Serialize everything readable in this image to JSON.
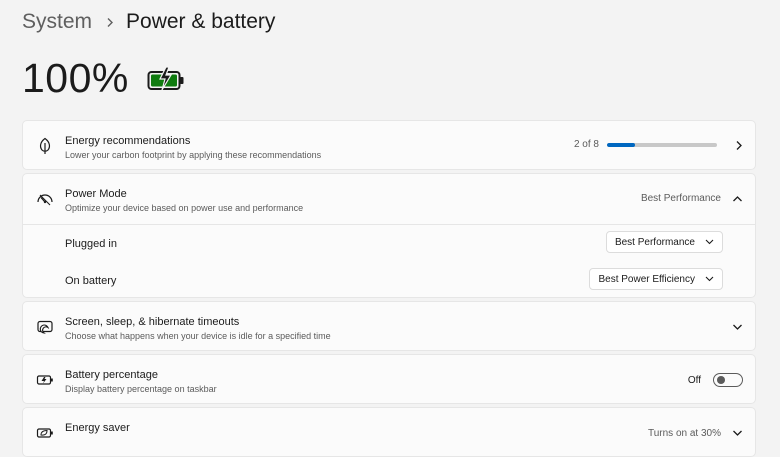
{
  "breadcrumb": {
    "parent": "System",
    "current": "Power & battery"
  },
  "battery": {
    "percent_text": "100%",
    "charge_level": 1.0,
    "color": "#107c10"
  },
  "energy_recommendations": {
    "title": "Energy recommendations",
    "subtitle": "Lower your carbon footprint by applying these recommendations",
    "progress_text": "2 of 8",
    "progress": 0.25,
    "icon": "leaf-icon"
  },
  "power_mode": {
    "title": "Power Mode",
    "subtitle": "Optimize your device based on power use and performance",
    "value": "Best Performance",
    "icon": "power-mode-icon",
    "plugged_in": {
      "label": "Plugged in",
      "value": "Best Performance"
    },
    "on_battery": {
      "label": "On battery",
      "value": "Best Power Efficiency"
    }
  },
  "screen_sleep": {
    "title": "Screen, sleep, & hibernate timeouts",
    "subtitle": "Choose what happens when your device is idle for a specified time",
    "icon": "screen-sleep-icon"
  },
  "battery_percentage": {
    "title": "Battery percentage",
    "subtitle": "Display battery percentage on taskbar",
    "toggle_label": "Off",
    "toggle_on": false,
    "icon": "battery-percentage-icon"
  },
  "energy_saver": {
    "title": "Energy saver",
    "value": "Turns on at 30%",
    "icon": "energy-saver-icon"
  },
  "colors": {
    "accent": "#0067c0",
    "battery_green": "#107c10"
  }
}
